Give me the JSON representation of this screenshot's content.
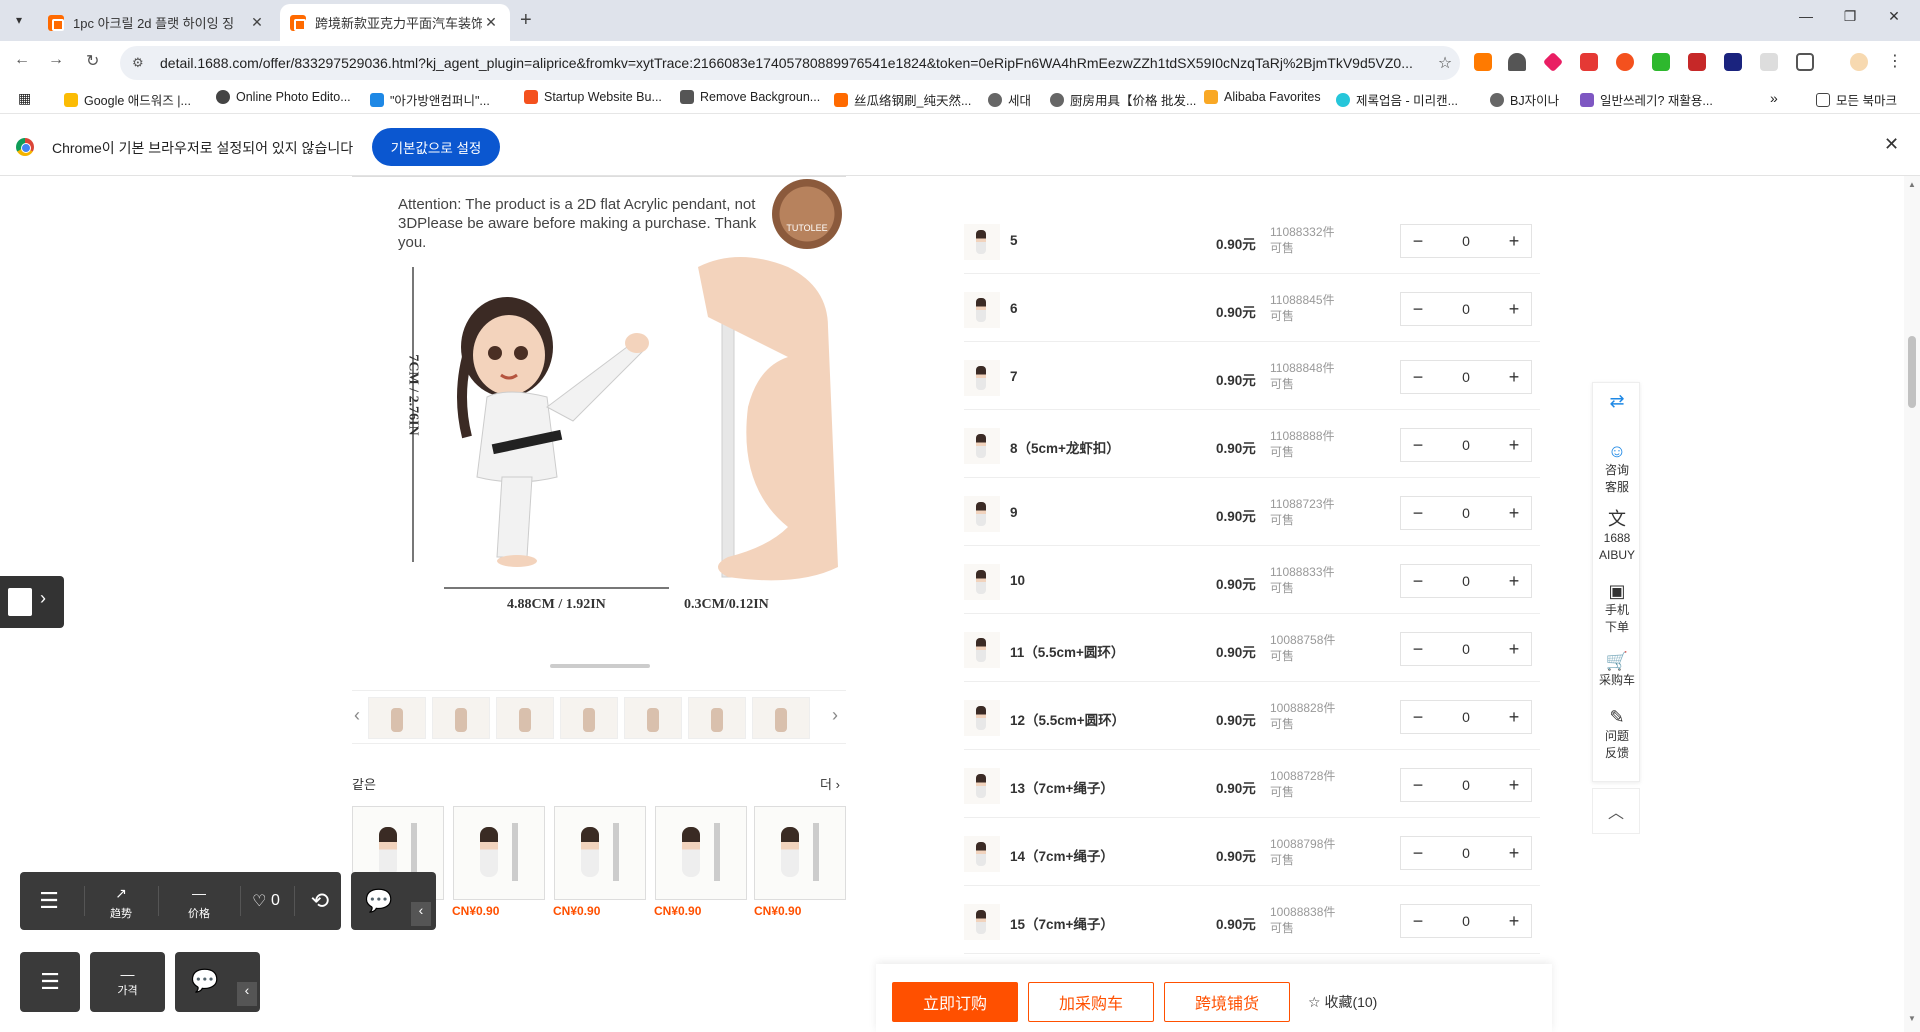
{
  "browser": {
    "tabs": [
      {
        "title": "1pc 아크릴 2d 플랫 하이잉 징",
        "active": false
      },
      {
        "title": "跨境新款亚克力平面汽车装饰挂",
        "active": true
      }
    ],
    "url": "detail.1688.com/offer/833297529036.html?kj_agent_plugin=aliprice&fromkv=xytTrace:2166083e17405780889976541e1824&token=0eRipFn6WA4hRmEezwZZh1tdSX59I0cNzqTaRj%2BjmTkV9d5VZ0...",
    "bookmarks": [
      "Google 애드워즈 |...",
      "Online Photo Edito...",
      "\"아가방앤컴퍼니\"...",
      "Startup Website Bu...",
      "Remove Backgroun...",
      "丝瓜络钢刷_纯天然...",
      "세대",
      "厨房用具【价格 批发...",
      "Alibaba Favorites",
      "제록업음 - 미리캔...",
      "BJ자이나",
      "일반쓰레기? 재활용...",
      "모든 북마크"
    ],
    "infobar": {
      "message": "Chrome이 기본 브라우저로 설정되어 있지 않습니다",
      "button": "기본값으로 설정"
    }
  },
  "product_image": {
    "attention": "Attention: The product is a 2D flat Acrylic pendant, not 3DPlease be aware before making a purchase. Thank you.",
    "brand_seal": "TUTOLEE",
    "height_label": "7CM / 2.76IN",
    "width_label": "4.88CM / 1.92IN",
    "depth_label": "0.3CM/0.12IN"
  },
  "same_section": {
    "title": "같은",
    "more": "더",
    "prices": [
      "CN¥0.90",
      "CN¥0.90",
      "CN¥0.90",
      "CN¥0.90",
      "CN¥0.90"
    ]
  },
  "floating_tools": {
    "trend": "趋势",
    "price": "价格",
    "likes": "0",
    "price_kr": "가격"
  },
  "sku_list": [
    {
      "name": "5",
      "price": "0.90元",
      "stock": "11088332件",
      "avail": "可售",
      "qty": "0"
    },
    {
      "name": "6",
      "price": "0.90元",
      "stock": "11088845件",
      "avail": "可售",
      "qty": "0"
    },
    {
      "name": "7",
      "price": "0.90元",
      "stock": "11088848件",
      "avail": "可售",
      "qty": "0"
    },
    {
      "name": "8（5cm+龙虾扣）",
      "price": "0.90元",
      "stock": "11088888件",
      "avail": "可售",
      "qty": "0"
    },
    {
      "name": "9",
      "price": "0.90元",
      "stock": "11088723件",
      "avail": "可售",
      "qty": "0"
    },
    {
      "name": "10",
      "price": "0.90元",
      "stock": "11088833件",
      "avail": "可售",
      "qty": "0"
    },
    {
      "name": "11（5.5cm+圆环）",
      "price": "0.90元",
      "stock": "10088758件",
      "avail": "可售",
      "qty": "0"
    },
    {
      "name": "12（5.5cm+圆环）",
      "price": "0.90元",
      "stock": "10088828件",
      "avail": "可售",
      "qty": "0"
    },
    {
      "name": "13（7cm+绳子）",
      "price": "0.90元",
      "stock": "10088728件",
      "avail": "可售",
      "qty": "0"
    },
    {
      "name": "14（7cm+绳子）",
      "price": "0.90元",
      "stock": "10088798件",
      "avail": "可售",
      "qty": "0"
    },
    {
      "name": "15（7cm+绳子）",
      "price": "0.90元",
      "stock": "10088838件",
      "avail": "可售",
      "qty": "0"
    }
  ],
  "service_bar": {
    "consult_1": "咨询",
    "consult_2": "客服",
    "aibuy_1": "1688",
    "aibuy_2": "AIBUY",
    "mobile_1": "手机",
    "mobile_2": "下单",
    "cart": "采购车",
    "feedback_1": "问题",
    "feedback_2": "反馈"
  },
  "actions": {
    "buy_now": "立即订购",
    "add_cart": "加采购车",
    "cross_border": "跨境铺货",
    "favorite": "收藏(10)"
  },
  "colors": {
    "accent": "#ff5000",
    "chrome_blue": "#0b57d0"
  }
}
